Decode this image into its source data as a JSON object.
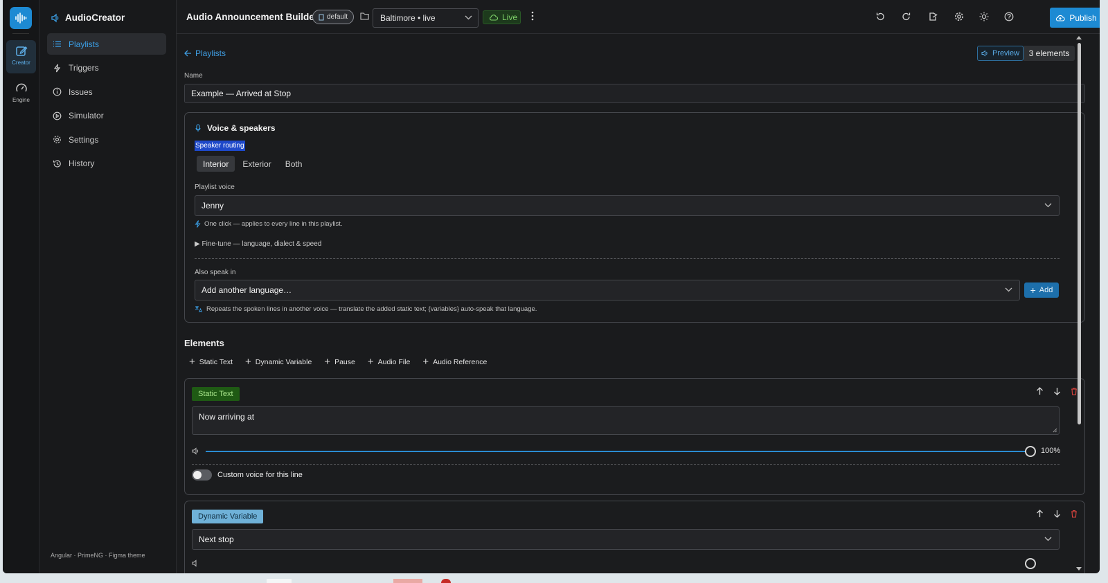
{
  "app": {
    "name": "AudioCreator"
  },
  "rail": [
    {
      "label": "Creator",
      "icon": "pencil-square-icon"
    },
    {
      "label": "Engine",
      "icon": "gauge-icon"
    }
  ],
  "sidebar": {
    "items": [
      {
        "label": "Playlists",
        "icon": "list-icon"
      },
      {
        "label": "Triggers",
        "icon": "bolt-icon"
      },
      {
        "label": "Issues",
        "icon": "info-circle-icon"
      },
      {
        "label": "Simulator",
        "icon": "play-circle-icon"
      },
      {
        "label": "Settings",
        "icon": "gear-icon"
      },
      {
        "label": "History",
        "icon": "history-icon"
      }
    ],
    "footer": "Angular · PrimeNG · Figma theme"
  },
  "topbar": {
    "title": "Audio Announcement Builder",
    "badge": "default",
    "location": "Baltimore • live",
    "status": "Live",
    "publish": "Publish"
  },
  "main": {
    "back_label": "Playlists",
    "preview_label": "Preview",
    "element_count": "3 elements",
    "name_label": "Name",
    "name_value": "Example — Arrived at Stop"
  },
  "voice": {
    "title": "Voice & speakers",
    "routing_label": "Speaker routing",
    "routing_options": [
      "Interior",
      "Exterior",
      "Both"
    ],
    "routing_selected": "Interior",
    "playlist_voice_label": "Playlist voice",
    "playlist_voice": "Jenny",
    "one_click_hint": "One click — applies to every line in this playlist.",
    "fine_tune": "▶ Fine-tune — language, dialect & speed",
    "also_speak_label": "Also speak in",
    "add_language_placeholder": "Add another language…",
    "add_label": "Add",
    "repeat_hint": "Repeats the spoken lines in another voice — translate the added static text; {variables} auto-speak that language."
  },
  "elements": {
    "heading": "Elements",
    "add_buttons": [
      "Static Text",
      "Dynamic Variable",
      "Pause",
      "Audio File",
      "Audio Reference"
    ],
    "items": [
      {
        "type": "Static Text",
        "text": "Now arriving at",
        "volume": "100%",
        "custom_voice_label": "Custom voice for this line",
        "custom_voice_on": false
      },
      {
        "type": "Dynamic Variable",
        "variable": "Next stop"
      }
    ]
  },
  "colors": {
    "accent": "#1d8ad3",
    "live": "#7fd36a",
    "danger": "#e0443e"
  }
}
